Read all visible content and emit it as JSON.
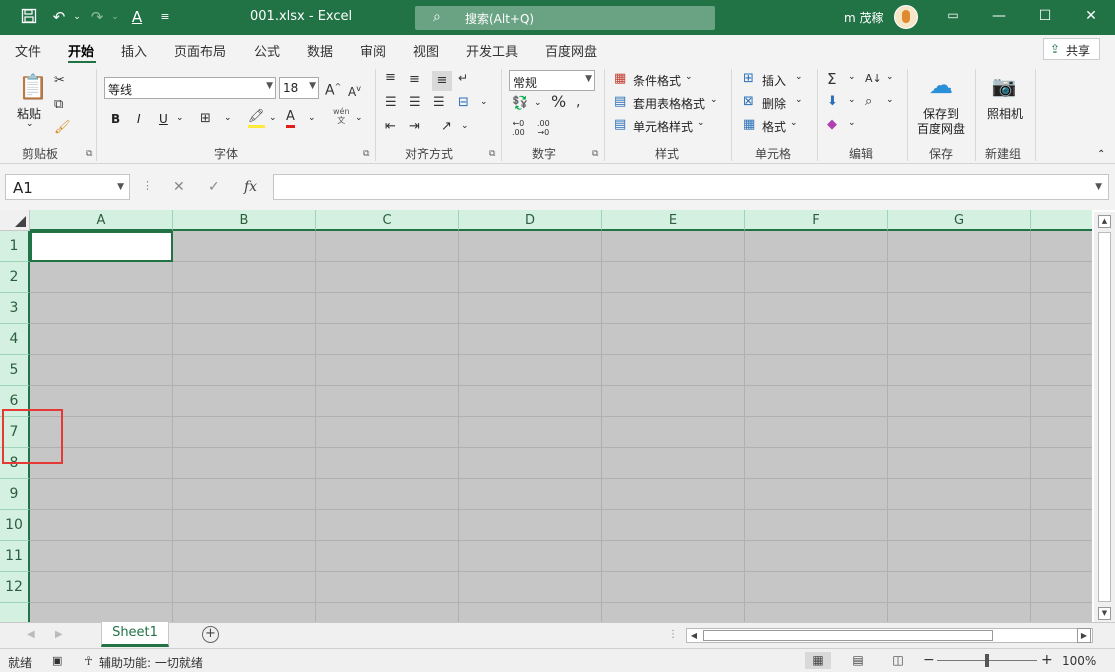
{
  "titlebar": {
    "filename": "001.xlsx",
    "app": "Excel",
    "search_placeholder": "搜索(Alt+Q)",
    "user": "m 茂稼"
  },
  "tabs": [
    "文件",
    "开始",
    "插入",
    "页面布局",
    "公式",
    "数据",
    "审阅",
    "视图",
    "开发工具",
    "百度网盘"
  ],
  "active_tab": "开始",
  "share_label": "共享",
  "ribbon": {
    "clipboard": {
      "paste": "粘贴",
      "label": "剪贴板"
    },
    "font": {
      "name": "等线",
      "size": "18",
      "bold": "B",
      "italic": "I",
      "underline": "U",
      "label": "字体"
    },
    "alignment": {
      "label": "对齐方式"
    },
    "number": {
      "format": "常规",
      "label": "数字"
    },
    "styles": {
      "conditional": "条件格式",
      "table": "套用表格格式",
      "cell": "单元格样式",
      "label": "样式"
    },
    "cells": {
      "insert": "插入",
      "delete": "删除",
      "format": "格式",
      "label": "单元格"
    },
    "editing": {
      "label": "编辑"
    },
    "save": {
      "line1": "保存到",
      "line2": "百度网盘",
      "label": "保存"
    },
    "newgroup": {
      "camera": "照相机",
      "label": "新建组"
    }
  },
  "namebox": "A1",
  "fx_label": "fx",
  "columns": [
    "A",
    "B",
    "C",
    "D",
    "E",
    "F",
    "G"
  ],
  "rows": [
    "1",
    "2",
    "3",
    "4",
    "5",
    "6",
    "7",
    "8",
    "9",
    "10",
    "11",
    "12"
  ],
  "sheet_tab": "Sheet1",
  "status": {
    "ready": "就绪",
    "accessibility": "辅助功能: 一切就绪",
    "zoom": "100%"
  },
  "colors": {
    "accent": "#217346",
    "selection_fill": "#c6c6c6",
    "header_highlight": "#d3f0e0",
    "annotation": "#e53935"
  }
}
